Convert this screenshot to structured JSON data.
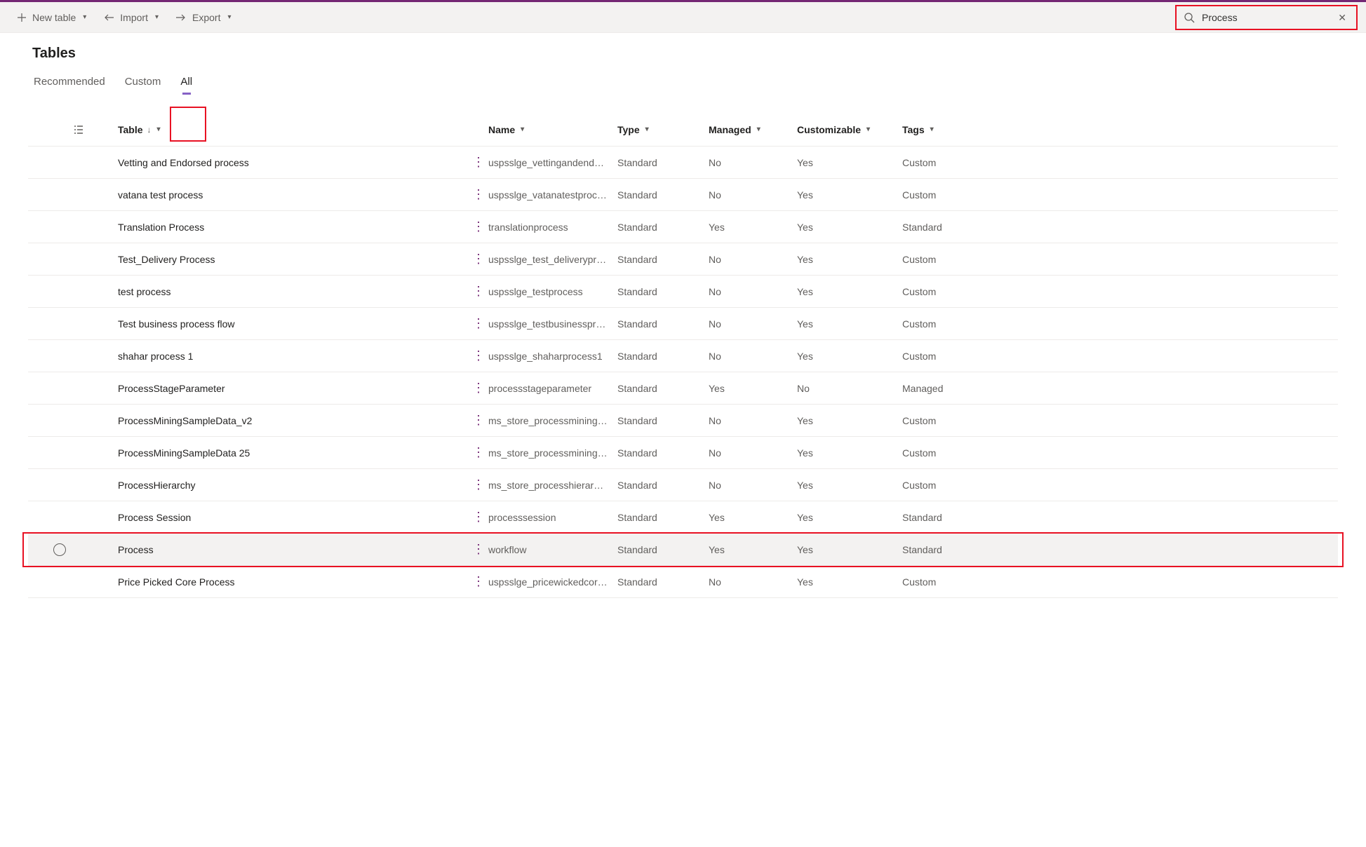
{
  "toolbar": {
    "new_table": "New table",
    "import": "Import",
    "export": "Export"
  },
  "search": {
    "value": "Process"
  },
  "page_title": "Tables",
  "tabs": {
    "recommended": "Recommended",
    "custom": "Custom",
    "all": "All"
  },
  "columns": {
    "table": "Table",
    "name": "Name",
    "type": "Type",
    "managed": "Managed",
    "customizable": "Customizable",
    "tags": "Tags"
  },
  "rows": [
    {
      "table": "Vetting and Endorsed process",
      "name": "uspsslge_vettingandendor...",
      "type": "Standard",
      "managed": "No",
      "customizable": "Yes",
      "tags": "Custom"
    },
    {
      "table": "vatana test process",
      "name": "uspsslge_vatanatestprocess",
      "type": "Standard",
      "managed": "No",
      "customizable": "Yes",
      "tags": "Custom"
    },
    {
      "table": "Translation Process",
      "name": "translationprocess",
      "type": "Standard",
      "managed": "Yes",
      "customizable": "Yes",
      "tags": "Standard"
    },
    {
      "table": "Test_Delivery Process",
      "name": "uspsslge_test_deliveryproc...",
      "type": "Standard",
      "managed": "No",
      "customizable": "Yes",
      "tags": "Custom"
    },
    {
      "table": "test process",
      "name": "uspsslge_testprocess",
      "type": "Standard",
      "managed": "No",
      "customizable": "Yes",
      "tags": "Custom"
    },
    {
      "table": "Test business process flow",
      "name": "uspsslge_testbusinessproc...",
      "type": "Standard",
      "managed": "No",
      "customizable": "Yes",
      "tags": "Custom"
    },
    {
      "table": "shahar process 1",
      "name": "uspsslge_shaharprocess1",
      "type": "Standard",
      "managed": "No",
      "customizable": "Yes",
      "tags": "Custom"
    },
    {
      "table": "ProcessStageParameter",
      "name": "processstageparameter",
      "type": "Standard",
      "managed": "Yes",
      "customizable": "No",
      "tags": "Managed"
    },
    {
      "table": "ProcessMiningSampleData_v2",
      "name": "ms_store_processminings...",
      "type": "Standard",
      "managed": "No",
      "customizable": "Yes",
      "tags": "Custom"
    },
    {
      "table": "ProcessMiningSampleData 25",
      "name": "ms_store_processminings...",
      "type": "Standard",
      "managed": "No",
      "customizable": "Yes",
      "tags": "Custom"
    },
    {
      "table": "ProcessHierarchy",
      "name": "ms_store_processhierarchy",
      "type": "Standard",
      "managed": "No",
      "customizable": "Yes",
      "tags": "Custom"
    },
    {
      "table": "Process Session",
      "name": "processsession",
      "type": "Standard",
      "managed": "Yes",
      "customizable": "Yes",
      "tags": "Standard"
    },
    {
      "table": "Process",
      "name": "workflow",
      "type": "Standard",
      "managed": "Yes",
      "customizable": "Yes",
      "tags": "Standard",
      "selected": true
    },
    {
      "table": "Price Picked Core Process",
      "name": "uspsslge_pricewickedcore...",
      "type": "Standard",
      "managed": "No",
      "customizable": "Yes",
      "tags": "Custom"
    }
  ]
}
